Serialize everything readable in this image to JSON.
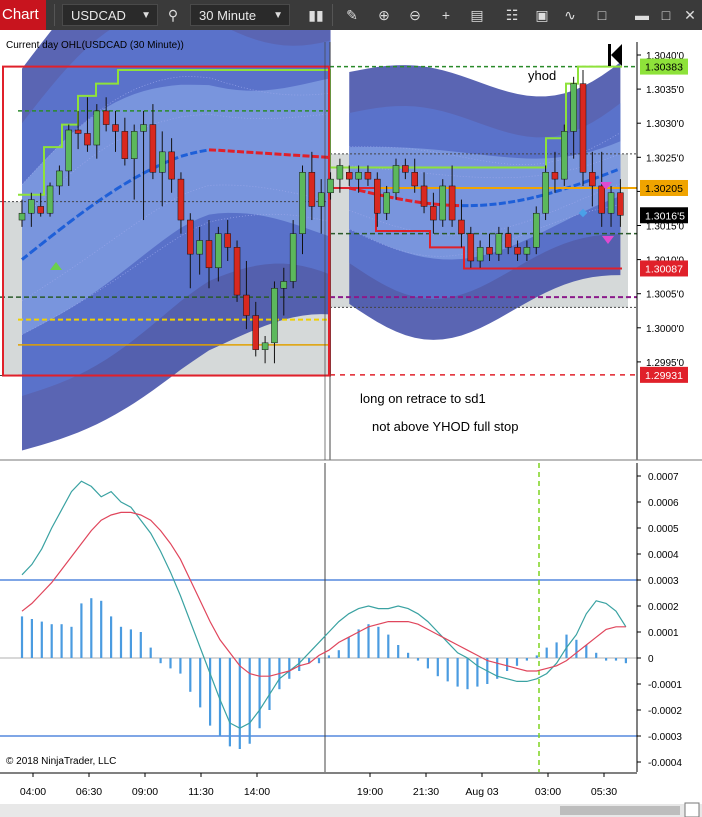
{
  "toolbar": {
    "chart_label": "Chart",
    "instrument": "USDCAD",
    "interval": "30 Minute",
    "icons": [
      "search-icon",
      "bar-type-icon",
      "pencil-icon",
      "zoom-in-icon",
      "zoom-out-icon",
      "crosshair-icon",
      "data-box-icon",
      "properties-icon",
      "strategies-icon",
      "indicators-icon",
      "window-icon",
      "minimize-icon",
      "maximize-icon",
      "close-icon"
    ]
  },
  "indicator_label": "Current day OHL(USDCAD (30 Minute))",
  "copyright": "© 2018 NinjaTrader, LLC",
  "annotations": {
    "yhod": "yhod",
    "line1": "long on retrace to sd1",
    "line2": "not above YHOD  full stop"
  },
  "colors": {
    "bull": "#5cb85c",
    "bear": "#d9281f",
    "band_outer": "#39459f",
    "band_inner": "#5c79d1",
    "ohl_high": "#8ee23a",
    "ohl_low": "#e0202a",
    "vwap_blue": "#1e5fd8",
    "vwap_red": "#e0202a",
    "macd": "#3aa2a2",
    "signal": "#e0465c",
    "hist": "#4a9be0"
  },
  "chart_data": [
    {
      "type": "candlestick",
      "instrument": "USDCAD",
      "interval": "30 Minute",
      "ylim": [
        1.2993,
        1.30415
      ],
      "y_ticks": [
        "1.3040'0",
        "1.3035'0",
        "1.3030'0",
        "1.3025'0",
        "1.3020'0",
        "1.3015'0",
        "1.3010'0",
        "1.3005'0",
        "1.3000'0",
        "1.2995'0"
      ],
      "price_labels": [
        {
          "text": "1.30383",
          "value": 1.30383,
          "color": "#8ee23a"
        },
        {
          "text": "1.30205",
          "value": 1.30205,
          "color": "#f0a400"
        },
        {
          "text": "1.3016'5",
          "value": 1.30165,
          "color": "#000000"
        },
        {
          "text": "1.30087",
          "value": 1.30087,
          "color": "#e0202a"
        },
        {
          "text": "1.29931",
          "value": 1.29931,
          "color": "#e0202a"
        }
      ],
      "x_ticks": [
        "04:00",
        "06:30",
        "09:00",
        "11:30",
        "14:00",
        "19:00",
        "21:30",
        "Aug 03",
        "03:00",
        "05:30"
      ],
      "candles": [
        {
          "o": 1.30158,
          "h": 1.30188,
          "l": 1.30148,
          "c": 1.30168
        },
        {
          "o": 1.30168,
          "h": 1.30198,
          "l": 1.30148,
          "c": 1.30188
        },
        {
          "o": 1.30178,
          "h": 1.30198,
          "l": 1.30163,
          "c": 1.30168
        },
        {
          "o": 1.30168,
          "h": 1.30213,
          "l": 1.30163,
          "c": 1.30208
        },
        {
          "o": 1.30208,
          "h": 1.30238,
          "l": 1.30195,
          "c": 1.3023
        },
        {
          "o": 1.3023,
          "h": 1.30298,
          "l": 1.30208,
          "c": 1.3029
        },
        {
          "o": 1.3029,
          "h": 1.30318,
          "l": 1.30262,
          "c": 1.30285
        },
        {
          "o": 1.30285,
          "h": 1.30338,
          "l": 1.30258,
          "c": 1.30268
        },
        {
          "o": 1.30268,
          "h": 1.30328,
          "l": 1.30248,
          "c": 1.30318
        },
        {
          "o": 1.30318,
          "h": 1.30338,
          "l": 1.30288,
          "c": 1.30298
        },
        {
          "o": 1.30298,
          "h": 1.30318,
          "l": 1.30258,
          "c": 1.30288
        },
        {
          "o": 1.30288,
          "h": 1.30308,
          "l": 1.30238,
          "c": 1.30248
        },
        {
          "o": 1.30248,
          "h": 1.30298,
          "l": 1.30188,
          "c": 1.30288
        },
        {
          "o": 1.30288,
          "h": 1.30318,
          "l": 1.30158,
          "c": 1.30298
        },
        {
          "o": 1.30298,
          "h": 1.30328,
          "l": 1.30218,
          "c": 1.30228
        },
        {
          "o": 1.30228,
          "h": 1.30288,
          "l": 1.30178,
          "c": 1.30258
        },
        {
          "o": 1.30258,
          "h": 1.30278,
          "l": 1.30198,
          "c": 1.30218
        },
        {
          "o": 1.30218,
          "h": 1.30228,
          "l": 1.30138,
          "c": 1.30158
        },
        {
          "o": 1.30158,
          "h": 1.30168,
          "l": 1.30058,
          "c": 1.30108
        },
        {
          "o": 1.30108,
          "h": 1.30148,
          "l": 1.30078,
          "c": 1.30128
        },
        {
          "o": 1.30128,
          "h": 1.30158,
          "l": 1.30058,
          "c": 1.30088
        },
        {
          "o": 1.30088,
          "h": 1.30148,
          "l": 1.30068,
          "c": 1.30138
        },
        {
          "o": 1.30138,
          "h": 1.30158,
          "l": 1.30098,
          "c": 1.30118
        },
        {
          "o": 1.30118,
          "h": 1.30128,
          "l": 1.30038,
          "c": 1.30048
        },
        {
          "o": 1.30048,
          "h": 1.30098,
          "l": 1.29998,
          "c": 1.30018
        },
        {
          "o": 1.30018,
          "h": 1.30038,
          "l": 1.29958,
          "c": 1.29968
        },
        {
          "o": 1.29968,
          "h": 1.29988,
          "l": 1.29948,
          "c": 1.29978
        },
        {
          "o": 1.29978,
          "h": 1.30068,
          "l": 1.29948,
          "c": 1.30058
        },
        {
          "o": 1.30058,
          "h": 1.30088,
          "l": 1.30018,
          "c": 1.30068
        },
        {
          "o": 1.30068,
          "h": 1.30158,
          "l": 1.30058,
          "c": 1.30138
        },
        {
          "o": 1.30138,
          "h": 1.30238,
          "l": 1.30108,
          "c": 1.30228
        },
        {
          "o": 1.30228,
          "h": 1.30258,
          "l": 1.30158,
          "c": 1.30178
        },
        {
          "o": 1.30178,
          "h": 1.30218,
          "l": 1.30138,
          "c": 1.30198
        },
        {
          "o": 1.30198,
          "h": 1.30228,
          "l": 1.30188,
          "c": 1.30218
        },
        {
          "o": 1.30218,
          "h": 1.30248,
          "l": 1.30198,
          "c": 1.30238
        },
        {
          "o": 1.30228,
          "h": 1.30238,
          "l": 1.30208,
          "c": 1.30218
        },
        {
          "o": 1.30218,
          "h": 1.30238,
          "l": 1.30198,
          "c": 1.30228
        },
        {
          "o": 1.30228,
          "h": 1.30238,
          "l": 1.30208,
          "c": 1.30218
        },
        {
          "o": 1.30218,
          "h": 1.30228,
          "l": 1.30148,
          "c": 1.30168
        },
        {
          "o": 1.30168,
          "h": 1.30208,
          "l": 1.30158,
          "c": 1.30198
        },
        {
          "o": 1.30198,
          "h": 1.30248,
          "l": 1.30188,
          "c": 1.30238
        },
        {
          "o": 1.30238,
          "h": 1.30248,
          "l": 1.30218,
          "c": 1.30228
        },
        {
          "o": 1.30228,
          "h": 1.30248,
          "l": 1.30198,
          "c": 1.30208
        },
        {
          "o": 1.30208,
          "h": 1.30228,
          "l": 1.30168,
          "c": 1.30178
        },
        {
          "o": 1.30178,
          "h": 1.30198,
          "l": 1.30138,
          "c": 1.30158
        },
        {
          "o": 1.30158,
          "h": 1.30218,
          "l": 1.30148,
          "c": 1.30208
        },
        {
          "o": 1.30208,
          "h": 1.30238,
          "l": 1.30148,
          "c": 1.30158
        },
        {
          "o": 1.30158,
          "h": 1.30188,
          "l": 1.30118,
          "c": 1.30138
        },
        {
          "o": 1.30138,
          "h": 1.30148,
          "l": 1.30088,
          "c": 1.30098
        },
        {
          "o": 1.30098,
          "h": 1.30128,
          "l": 1.30088,
          "c": 1.30118
        },
        {
          "o": 1.30118,
          "h": 1.30138,
          "l": 1.30098,
          "c": 1.30108
        },
        {
          "o": 1.30108,
          "h": 1.30148,
          "l": 1.30098,
          "c": 1.30138
        },
        {
          "o": 1.30138,
          "h": 1.30148,
          "l": 1.30108,
          "c": 1.30118
        },
        {
          "o": 1.30118,
          "h": 1.30128,
          "l": 1.30098,
          "c": 1.30108
        },
        {
          "o": 1.30108,
          "h": 1.30128,
          "l": 1.30098,
          "c": 1.30118
        },
        {
          "o": 1.30118,
          "h": 1.30178,
          "l": 1.30108,
          "c": 1.30168
        },
        {
          "o": 1.30168,
          "h": 1.30238,
          "l": 1.30158,
          "c": 1.30228
        },
        {
          "o": 1.30228,
          "h": 1.30258,
          "l": 1.30198,
          "c": 1.30218
        },
        {
          "o": 1.30218,
          "h": 1.30298,
          "l": 1.30208,
          "c": 1.30288
        },
        {
          "o": 1.30288,
          "h": 1.30368,
          "l": 1.30248,
          "c": 1.30358
        },
        {
          "o": 1.30358,
          "h": 1.30378,
          "l": 1.30208,
          "c": 1.30228
        },
        {
          "o": 1.30228,
          "h": 1.30258,
          "l": 1.30178,
          "c": 1.30208
        },
        {
          "o": 1.30208,
          "h": 1.30258,
          "l": 1.30148,
          "c": 1.30168
        },
        {
          "o": 1.30168,
          "h": 1.30208,
          "l": 1.30148,
          "c": 1.30198
        },
        {
          "o": 1.30198,
          "h": 1.30218,
          "l": 1.30148,
          "c": 1.30165
        }
      ]
    },
    {
      "type": "line",
      "subtype": "macd",
      "ylim": [
        -0.00042,
        0.00078
      ],
      "y_ticks": [
        "0.0007",
        "0.0006",
        "0.0005",
        "0.0004",
        "0.0003",
        "0.0002",
        "0.0001",
        "0",
        "-0.0001",
        "-0.0002",
        "-0.0003",
        "-0.0004"
      ],
      "levels": [
        0.0003,
        -0.0003
      ],
      "series": [
        {
          "values": [
            0.00032,
            0.00036,
            0.00042,
            0.0005,
            0.00057,
            0.00064,
            0.00068,
            0.00066,
            0.00062,
            0.00064,
            0.0006,
            0.00058,
            0.00053,
            0.00048,
            0.00041,
            0.00033,
            0.00024,
            0.00014,
            4e-05,
            -6e-05,
            -0.00016,
            -0.00025,
            -0.00027,
            -0.00025,
            -0.0002,
            -0.00014,
            -8e-05,
            -5e-05,
            -2e-05,
            2e-05,
            6e-05,
            0.0001,
            0.00014,
            0.00017,
            0.00019,
            0.0002,
            0.00019,
            0.00019,
            0.0002,
            0.00019,
            0.00017,
            0.00014,
            0.0001,
            6e-05,
            2e-05,
            0.0,
            -3e-05,
            -5e-05,
            -7e-05,
            -8e-05,
            -9e-05,
            -9e-05,
            -8e-05,
            -6e-05,
            -2e-05,
            4e-05,
            9e-05,
            0.00017,
            0.00022,
            0.00021,
            0.00018,
            0.00012
          ],
          "color": "#3aa2a2"
        },
        {
          "values": [
            0.00018,
            0.00021,
            0.00025,
            0.00029,
            0.00034,
            0.00039,
            0.00044,
            0.00049,
            0.00053,
            0.00055,
            0.00056,
            0.00056,
            0.00055,
            0.00053,
            0.00049,
            0.00044,
            0.00038,
            0.0003,
            0.00022,
            0.00014,
            7e-05,
            2e-05,
            -3e-05,
            -6e-05,
            -7e-05,
            -7e-05,
            -6e-05,
            -5e-05,
            -3e-05,
            -2e-05,
            1e-05,
            3e-05,
            6e-05,
            8e-05,
            0.0001,
            0.00012,
            0.00013,
            0.00014,
            0.00014,
            0.00014,
            0.00013,
            0.00011,
            9e-05,
            7e-05,
            5e-05,
            3e-05,
            1e-05,
            -1e-05,
            -2e-05,
            -3e-05,
            -4e-05,
            -5e-05,
            -5e-05,
            -4e-05,
            -3e-05,
            -1e-05,
            2e-05,
            5e-05,
            8e-05,
            0.00011,
            0.00012,
            0.00012
          ],
          "color": "#e0465c"
        }
      ],
      "histogram": [
        0.00016,
        0.00015,
        0.00014,
        0.00013,
        0.00013,
        0.00012,
        0.00021,
        0.00023,
        0.00022,
        0.00016,
        0.00012,
        0.00011,
        0.0001,
        4e-05,
        -2e-05,
        -4e-05,
        -6e-05,
        -0.00013,
        -0.00019,
        -0.00026,
        -0.0003,
        -0.00034,
        -0.00035,
        -0.00033,
        -0.00027,
        -0.0002,
        -0.00012,
        -8e-05,
        -5e-05,
        -2e-05,
        -2e-05,
        1e-05,
        3e-05,
        8e-05,
        0.00011,
        0.00013,
        0.00012,
        9e-05,
        5e-05,
        2e-05,
        -1e-05,
        -4e-05,
        -7e-05,
        -9e-05,
        -0.00011,
        -0.00012,
        -0.00011,
        -0.0001,
        -8e-05,
        -5e-05,
        -3e-05,
        -1e-05,
        1e-05,
        4e-05,
        6e-05,
        9e-05,
        7e-05,
        5e-05,
        2e-05,
        -1e-05,
        -1e-05,
        -2e-05
      ]
    }
  ]
}
